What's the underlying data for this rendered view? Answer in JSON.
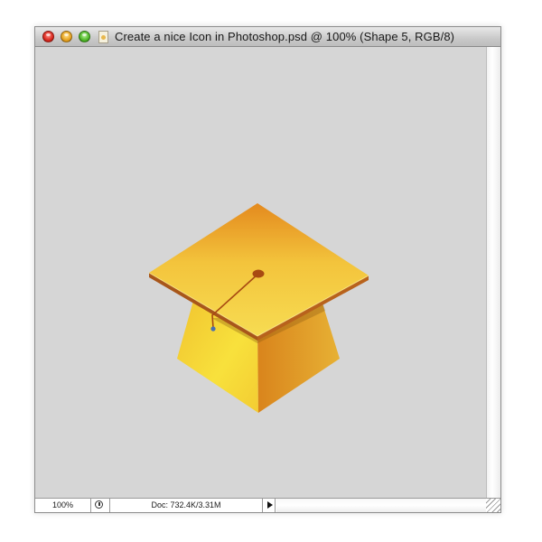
{
  "window": {
    "title": "Create a nice Icon in Photoshop.psd @ 100% (Shape 5, RGB/8)",
    "buttons": {
      "close": "close-icon",
      "minimize": "minimize-icon",
      "zoom": "zoom-icon"
    }
  },
  "canvas": {
    "background": "#d6d6d6",
    "artwork": "graduation-cap",
    "colors": {
      "board_top": "#f5d34a",
      "board_dark": "#e48a1e",
      "board_edge": "#a8561a",
      "body_light": "#f7d83a",
      "body_dark": "#d17a18",
      "tassel": "#a84a12",
      "anchor_point": "#4a6fb0"
    }
  },
  "status": {
    "zoom": "100%",
    "doc": "Doc: 732.4K/3.31M"
  }
}
